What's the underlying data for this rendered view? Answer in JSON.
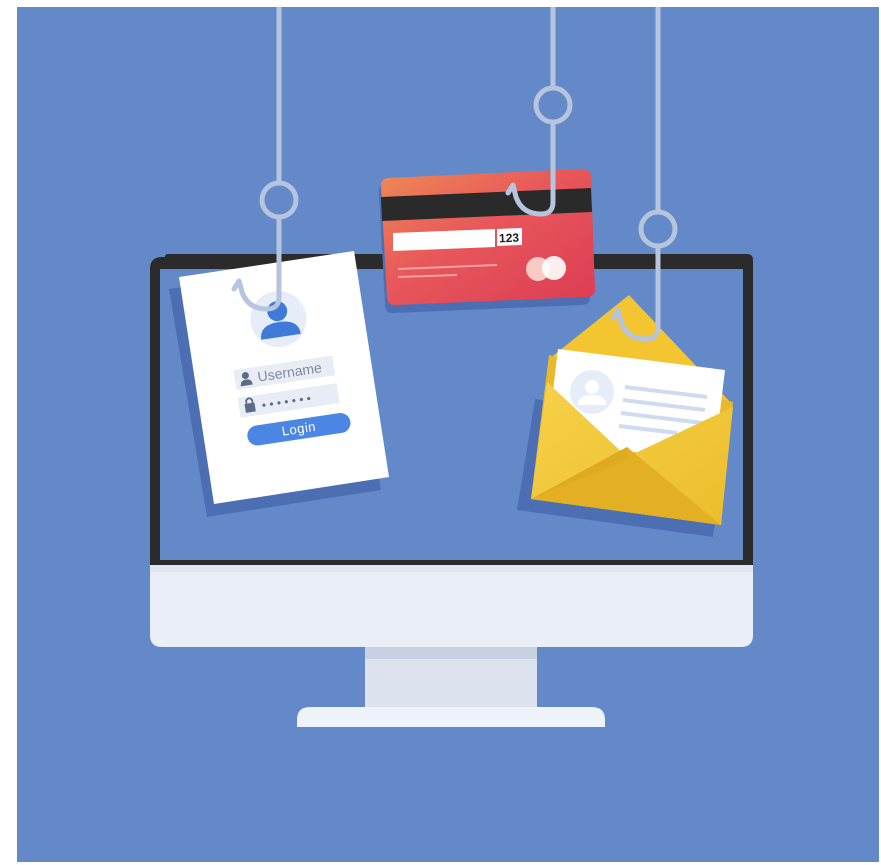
{
  "login_card": {
    "username_placeholder": "Username",
    "password_mask": "• • • • • • •",
    "login_button": "Login"
  },
  "credit_card": {
    "security_code": "123"
  },
  "icons": [
    "user-avatar-icon",
    "user-icon",
    "lock-icon",
    "fish-hook-icon",
    "envelope-icon",
    "mastercard-logo"
  ],
  "colors": {
    "background": "#6489c8",
    "monitor_bezel": "#2a2a2a",
    "card_red": "#e04a4f",
    "envelope_yellow": "#f2c531",
    "login_button": "#4b86e4"
  }
}
